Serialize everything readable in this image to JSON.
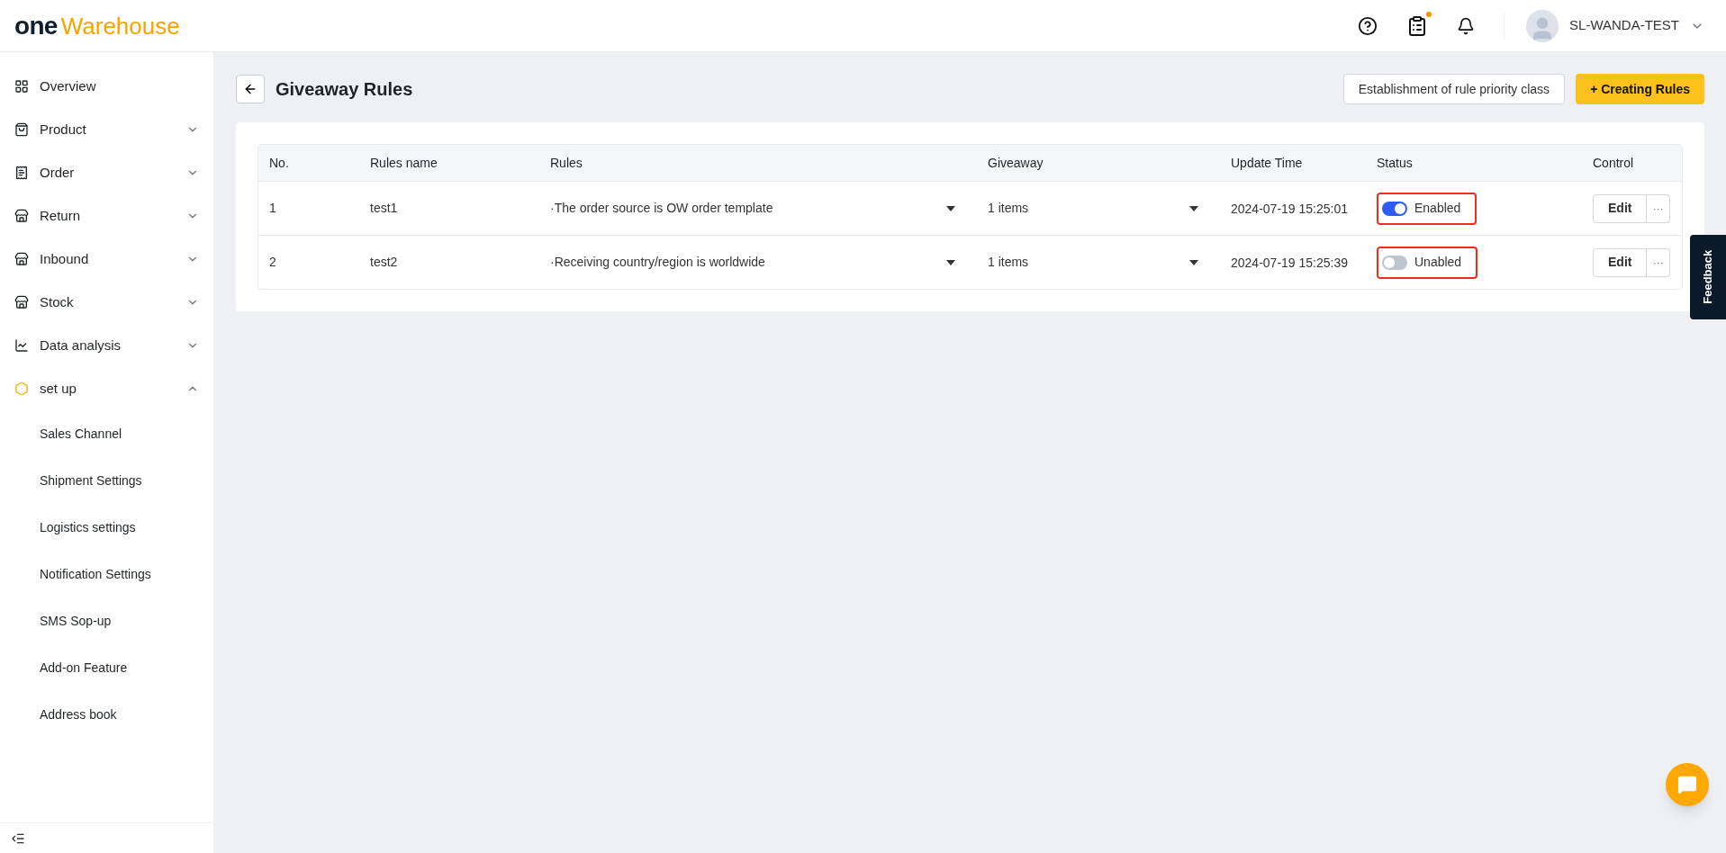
{
  "header": {
    "logo_one": "one",
    "logo_warehouse": "Warehouse",
    "notification_badge": true,
    "user": "SL-WANDA-TEST"
  },
  "sidebar": {
    "items": [
      {
        "label": "Overview"
      },
      {
        "label": "Product",
        "expanded": false
      },
      {
        "label": "Order",
        "expanded": false
      },
      {
        "label": "Return",
        "expanded": false
      },
      {
        "label": "Inbound",
        "expanded": false
      },
      {
        "label": "Stock",
        "expanded": false
      },
      {
        "label": "Data analysis",
        "expanded": false
      },
      {
        "label": "set up",
        "expanded": true,
        "children": [
          {
            "label": "Sales Channel"
          },
          {
            "label": "Shipment Settings"
          },
          {
            "label": "Logistics settings"
          },
          {
            "label": "Notification Settings"
          },
          {
            "label": "SMS Sop-up"
          },
          {
            "label": "Add-on Feature"
          },
          {
            "label": "Address book"
          }
        ]
      }
    ]
  },
  "page": {
    "title": "Giveaway Rules",
    "buttons": [
      {
        "label": "Establishment of rule priority class",
        "kind": "secondary"
      },
      {
        "label": "+ Creating Rules",
        "kind": "primary"
      }
    ]
  },
  "table": {
    "columns": [
      "No.",
      "Rules name",
      "Rules",
      "Giveaway",
      "Update Time",
      "Status",
      "Control"
    ],
    "rows": [
      {
        "no": "1",
        "name": "test1",
        "rule": "·The order source is OW order template",
        "giveaway": "1 items",
        "time": "2024-07-19 15:25:01",
        "on": true,
        "status": "Enabled",
        "highlighted": true,
        "edit": "Edit",
        "more": "···"
      },
      {
        "no": "2",
        "name": "test2",
        "rule": "·Receiving country/region is worldwide",
        "giveaway": "1 items",
        "time": "2024-07-19 15:25:39",
        "on": false,
        "status": "Unabled",
        "highlighted": true,
        "edit": "Edit",
        "more": "···"
      }
    ]
  },
  "feedback": "Feedback"
}
